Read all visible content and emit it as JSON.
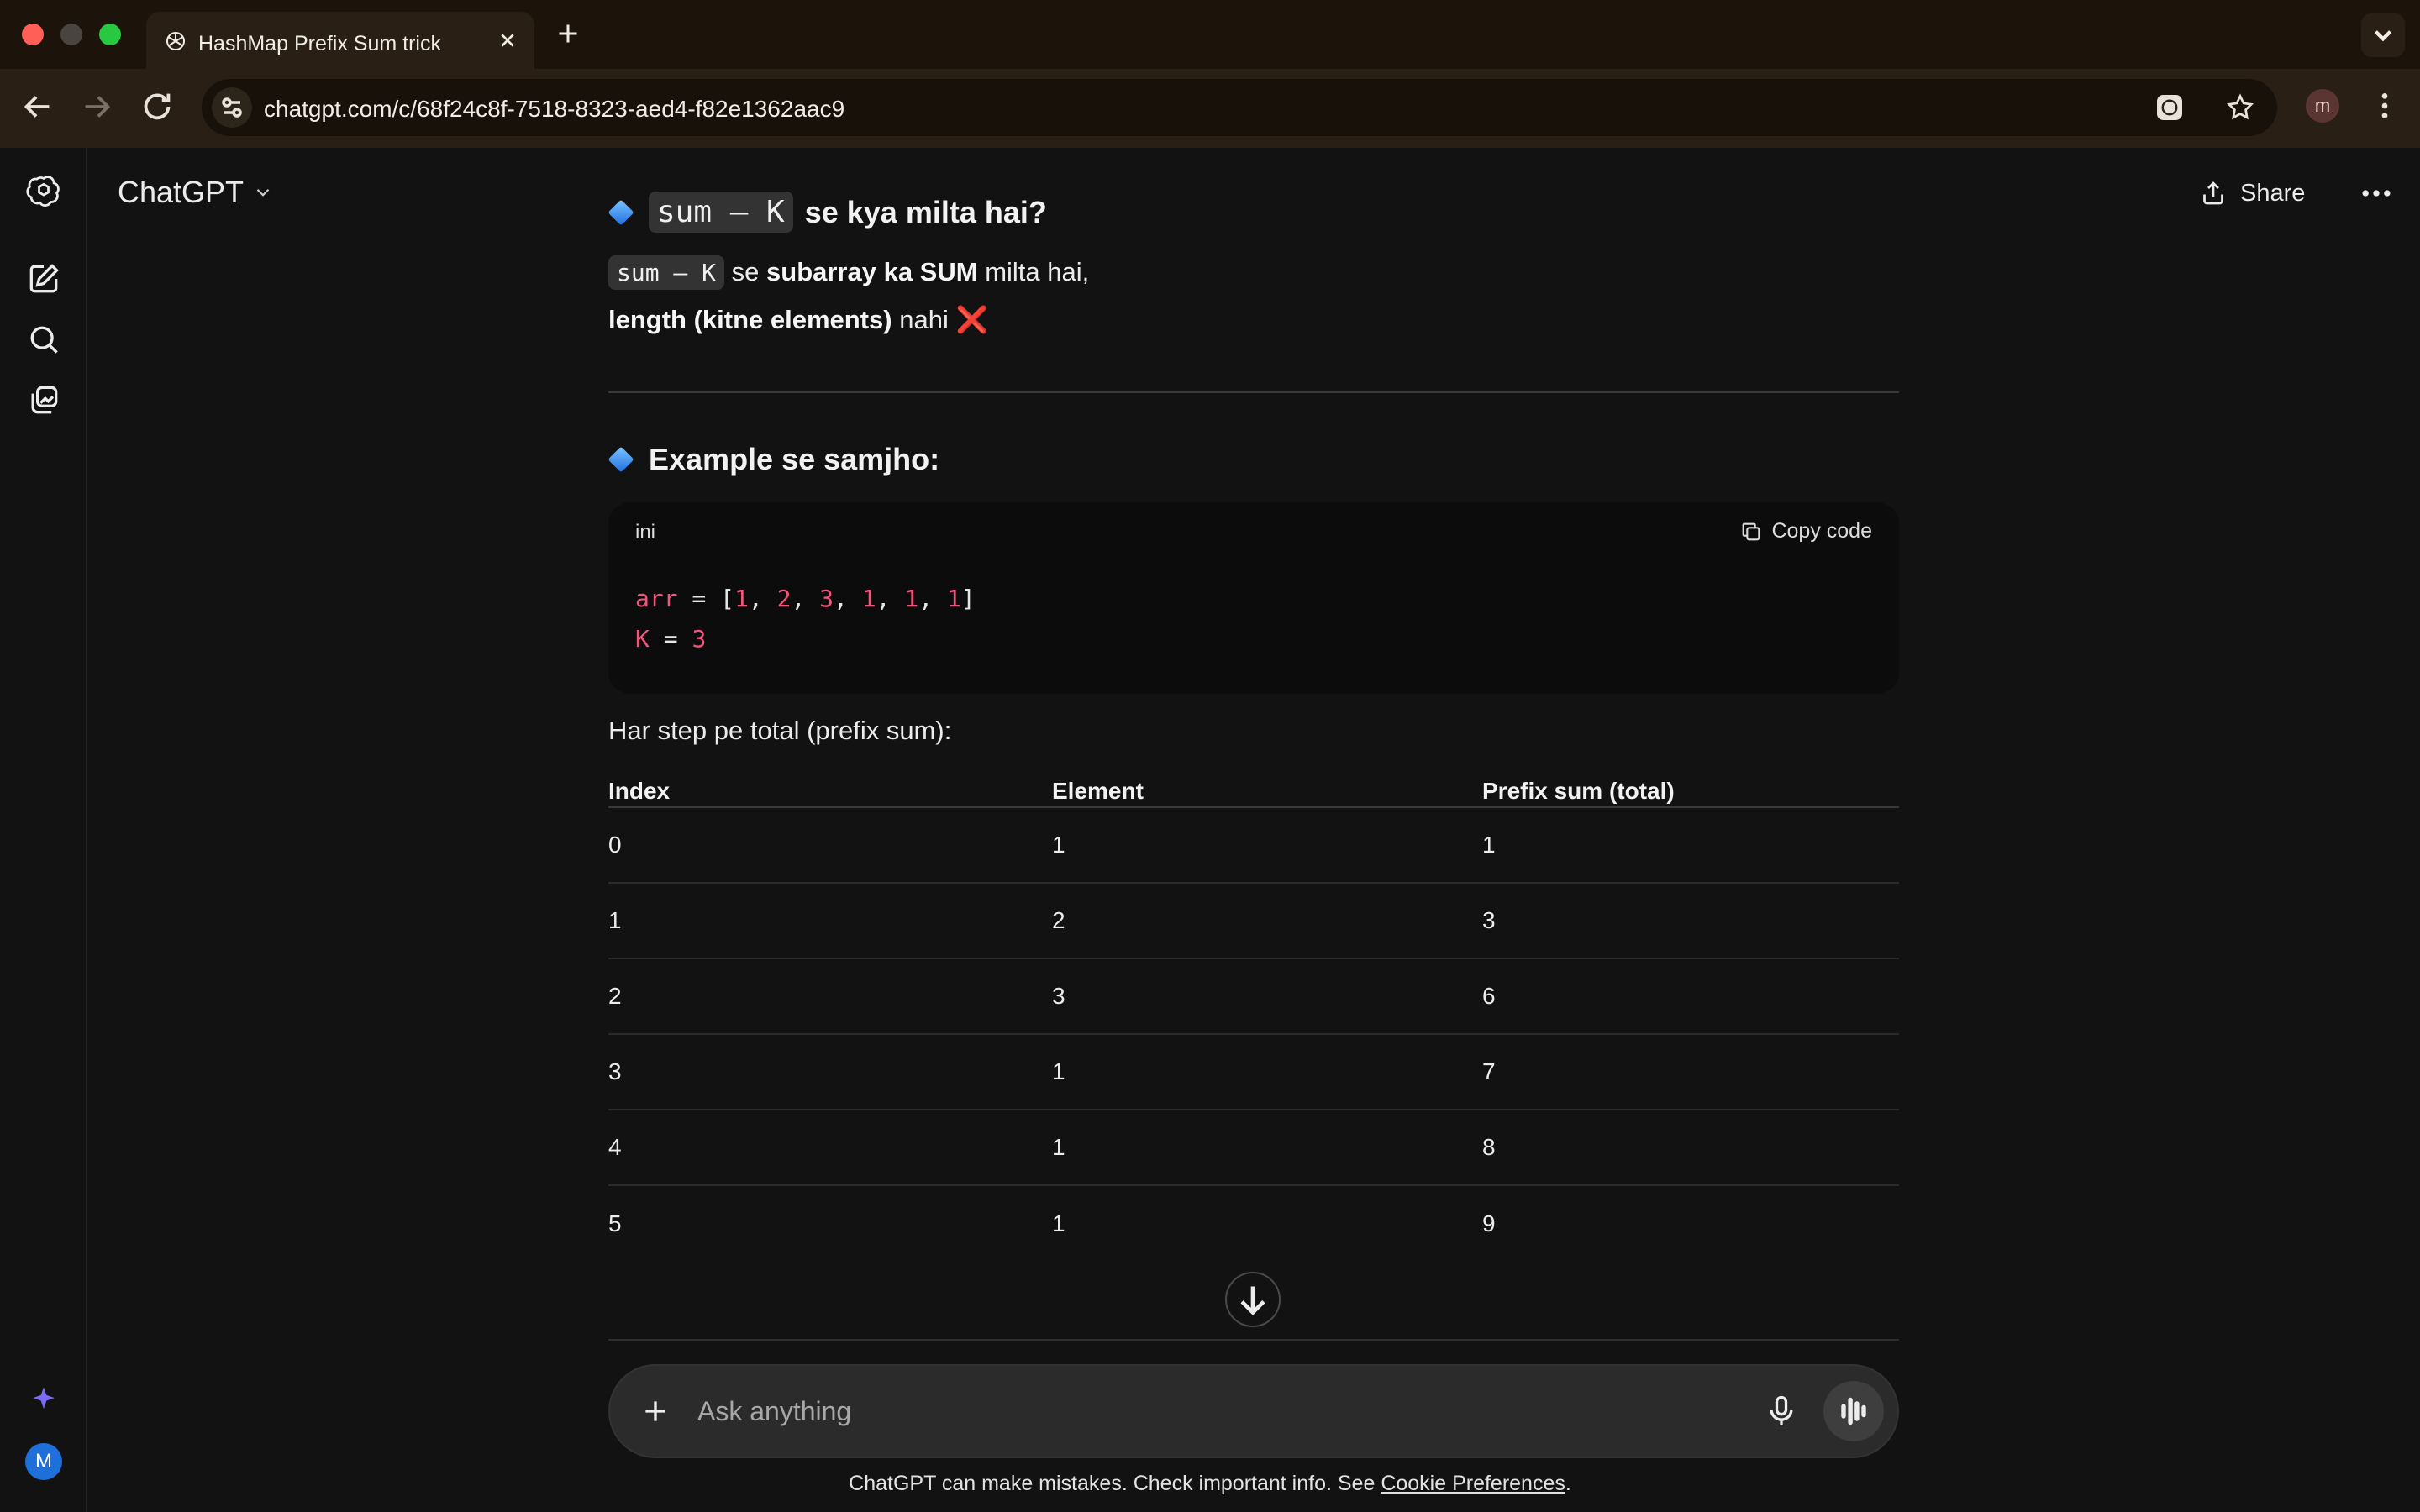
{
  "browser": {
    "tab_title": "HashMap Prefix Sum trick",
    "url": "chatgpt.com/c/68f24c8f-7518-8323-aed4-f82e1362aac9",
    "profile_initial": "m"
  },
  "app": {
    "title": "ChatGPT",
    "share_label": "Share",
    "avatar_initial": "M"
  },
  "message": {
    "section1": {
      "heading_code": "sum – K",
      "heading_rest": "se kya milta hai?",
      "line1_code": "sum – K",
      "line1_pre": "se",
      "line1_bold": "subarray ka SUM",
      "line1_post": "milta hai,",
      "line2_bold": "length (kitne elements)",
      "line2_post": "nahi",
      "cross_emoji": "❌"
    },
    "section2": {
      "heading": "Example se samjho:"
    },
    "codeblock": {
      "lang": "ini",
      "copy_label": "Copy code",
      "line1": {
        "var": "arr",
        "eq": " = [",
        "n1": "1",
        "c1": ", ",
        "n2": "2",
        "c2": ", ",
        "n3": "3",
        "c3": ", ",
        "n4": "1",
        "c4": ", ",
        "n5": "1",
        "c5": ", ",
        "n6": "1",
        "end": "]"
      },
      "line2": {
        "var": "K",
        "eq": " = ",
        "n1": "3"
      }
    },
    "table_intro": "Har step pe total (prefix sum):",
    "table": {
      "headers": [
        "Index",
        "Element",
        "Prefix sum (total)"
      ],
      "rows": [
        [
          "0",
          "1",
          "1"
        ],
        [
          "1",
          "2",
          "3"
        ],
        [
          "2",
          "3",
          "6"
        ],
        [
          "3",
          "1",
          "7"
        ],
        [
          "4",
          "1",
          "8"
        ],
        [
          "5",
          "1",
          "9"
        ]
      ]
    }
  },
  "composer": {
    "placeholder": "Ask anything"
  },
  "footer": {
    "text": "ChatGPT can make mistakes. Check important info. See",
    "link": "Cookie Preferences",
    "end": "."
  },
  "icons": {
    "openai_logo": "openai-logo-icon",
    "new_chat": "new-chat-icon",
    "search": "search-icon",
    "library": "library-icon",
    "upgrade": "sparkle-icon"
  },
  "colors": {
    "code_token": "#f2547c",
    "avatar": "#1e6fd9"
  }
}
